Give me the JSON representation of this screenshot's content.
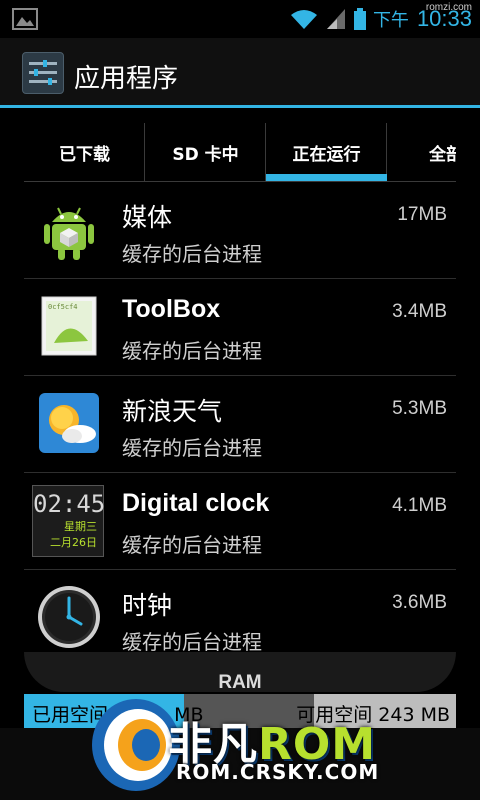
{
  "status_bar": {
    "ampm": "下午",
    "time": "10:33",
    "watermark": "romzi.com"
  },
  "action_bar": {
    "title": "应用程序"
  },
  "tabs": [
    {
      "label": "已下载",
      "active": false
    },
    {
      "label": "SD 卡中",
      "active": false
    },
    {
      "label": "正在运行",
      "active": true
    },
    {
      "label": "全部",
      "active": false
    }
  ],
  "apps": [
    {
      "name": "媒体",
      "status": "缓存的后台进程",
      "size": "17MB",
      "icon": "android-media-icon"
    },
    {
      "name": "ToolBox",
      "status": "缓存的后台进程",
      "size": "3.4MB",
      "icon": "toolbox-icon"
    },
    {
      "name": "新浪天气",
      "status": "缓存的后台进程",
      "size": "5.3MB",
      "icon": "weather-icon"
    },
    {
      "name": "Digital clock",
      "status": "缓存的后台进程",
      "size": "4.1MB",
      "icon": "digital-clock-icon"
    },
    {
      "name": "时钟",
      "status": "缓存的后台进程",
      "size": "3.6MB",
      "icon": "clock-icon"
    }
  ],
  "digital_clock_icon": {
    "time": "02:45",
    "weekday": "星期三",
    "date": "二月26日"
  },
  "ram": {
    "label": "RAM",
    "used_text": "已用空间",
    "used_value": "MB",
    "free_text": "可用空间",
    "free_value": "243 MB"
  },
  "logo": {
    "brand_cn": "非凡",
    "brand_en": "ROM",
    "url": "ROM.CRSKY.COM"
  },
  "colors": {
    "accent": "#33b5e5",
    "logo_green": "#b7e02e"
  }
}
